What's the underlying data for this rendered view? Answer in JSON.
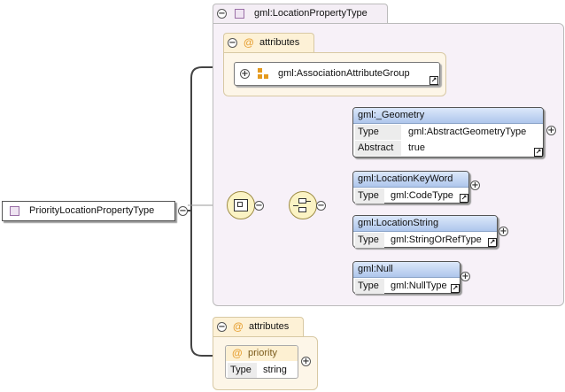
{
  "root": {
    "name": "PriorityLocationPropertyType"
  },
  "complex_type": {
    "name": "gml:LocationPropertyType",
    "attributes_label": "attributes",
    "attribute_group": {
      "name": "gml:AssociationAttributeGroup"
    }
  },
  "elements": [
    {
      "name": "gml:_Geometry",
      "rows": [
        {
          "key": "Type",
          "value": "gml:AbstractGeometryType"
        },
        {
          "key": "Abstract",
          "value": "true"
        }
      ]
    },
    {
      "name": "gml:LocationKeyWord",
      "rows": [
        {
          "key": "Type",
          "value": "gml:CodeType"
        }
      ]
    },
    {
      "name": "gml:LocationString",
      "rows": [
        {
          "key": "Type",
          "value": "gml:StringOrRefType"
        }
      ]
    },
    {
      "name": "gml:Null",
      "rows": [
        {
          "key": "Type",
          "value": "gml:NullType"
        }
      ]
    }
  ],
  "own_attributes": {
    "label": "attributes",
    "attribute": {
      "name": "priority",
      "rows": [
        {
          "key": "Type",
          "value": "string"
        }
      ]
    }
  },
  "colors": {
    "type_panel": "#f7f1f8",
    "attr_panel": "#fdf6e8",
    "element_header": "#aec6ec",
    "compositor": "#fbf3c4"
  },
  "icons": {
    "collapse": "minus-icon",
    "expand": "plus-icon",
    "complex_type": "complex-type-icon",
    "attribute": "at-icon",
    "attribute_group": "attribute-group-icon",
    "sequence": "sequence-compositor-icon",
    "choice": "choice-compositor-icon",
    "link": "link-arrow-icon"
  }
}
